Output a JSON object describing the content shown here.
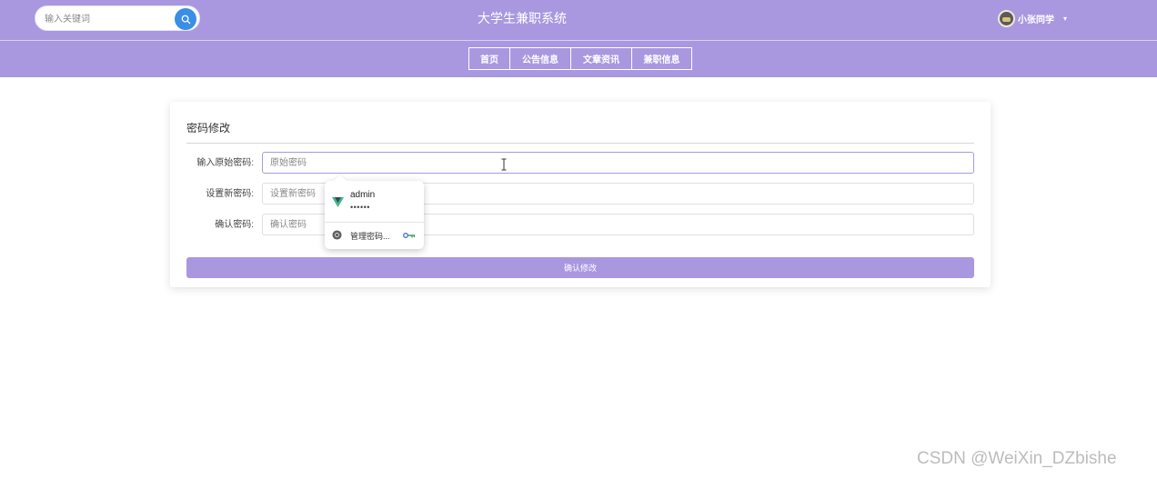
{
  "header": {
    "search_placeholder": "输入关键词",
    "title": "大学生兼职系统",
    "username": "小张同学"
  },
  "nav": {
    "items": [
      "首页",
      "公告信息",
      "文章资讯",
      "兼职信息"
    ]
  },
  "form": {
    "title": "密码修改",
    "fields": [
      {
        "label": "输入原始密码:",
        "placeholder": "原始密码"
      },
      {
        "label": "设置新密码:",
        "placeholder": "设置新密码"
      },
      {
        "label": "确认密码:",
        "placeholder": "确认密码"
      }
    ],
    "submit_label": "确认修改"
  },
  "autofill": {
    "username": "admin",
    "password_mask": "••••••",
    "manage_label": "管理密码..."
  },
  "watermark": "CSDN @WeiXin_DZbishe",
  "colors": {
    "theme": "#a998e0",
    "search_button": "#3a8ee6"
  }
}
